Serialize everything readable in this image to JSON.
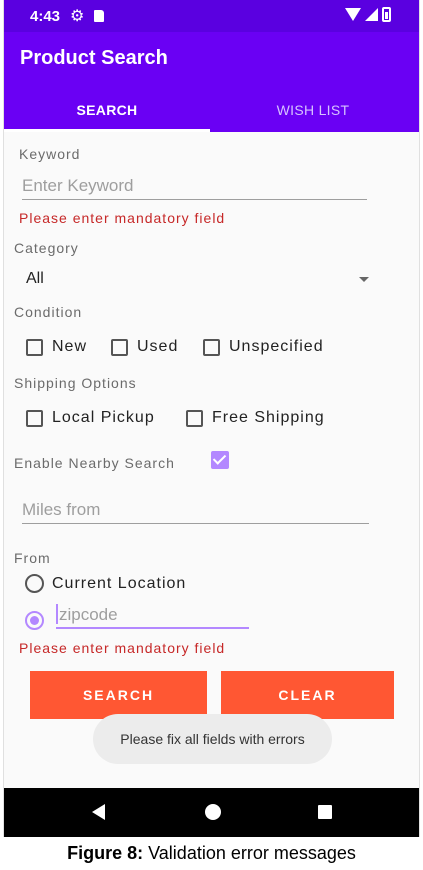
{
  "status_bar": {
    "time": "4:43",
    "icons": [
      "gear-icon",
      "sd-card-icon",
      "wifi-icon",
      "cell-signal-icon",
      "battery-icon"
    ]
  },
  "app_bar": {
    "title": "Product Search",
    "color": "#6a00f4"
  },
  "tabs": [
    {
      "label": "SEARCH",
      "selected": true
    },
    {
      "label": "WISH LIST",
      "selected": false
    }
  ],
  "form": {
    "keyword": {
      "label": "Keyword",
      "placeholder": "Enter Keyword",
      "error": "Please enter mandatory field"
    },
    "category": {
      "label": "Category",
      "selected": "All"
    },
    "condition": {
      "label": "Condition",
      "options": [
        {
          "label": "New",
          "checked": false
        },
        {
          "label": "Used",
          "checked": false
        },
        {
          "label": "Unspecified",
          "checked": false
        }
      ]
    },
    "shipping": {
      "label": "Shipping Options",
      "options": [
        {
          "label": "Local Pickup",
          "checked": false
        },
        {
          "label": "Free Shipping",
          "checked": false
        }
      ]
    },
    "nearby": {
      "label": "Enable Nearby Search",
      "checked": true
    },
    "miles": {
      "placeholder": "Miles from"
    },
    "from": {
      "label": "From",
      "current_location": {
        "label": "Current Location",
        "selected": false
      },
      "zipcode": {
        "placeholder": "zipcode",
        "selected": true
      },
      "error": "Please enter mandatory field"
    }
  },
  "buttons": {
    "search": "SEARCH",
    "clear": "CLEAR",
    "color": "#ff5733"
  },
  "toast": "Please fix all fields with errors",
  "caption": {
    "prefix": "Figure 8:",
    "text": " Validation error messages"
  }
}
